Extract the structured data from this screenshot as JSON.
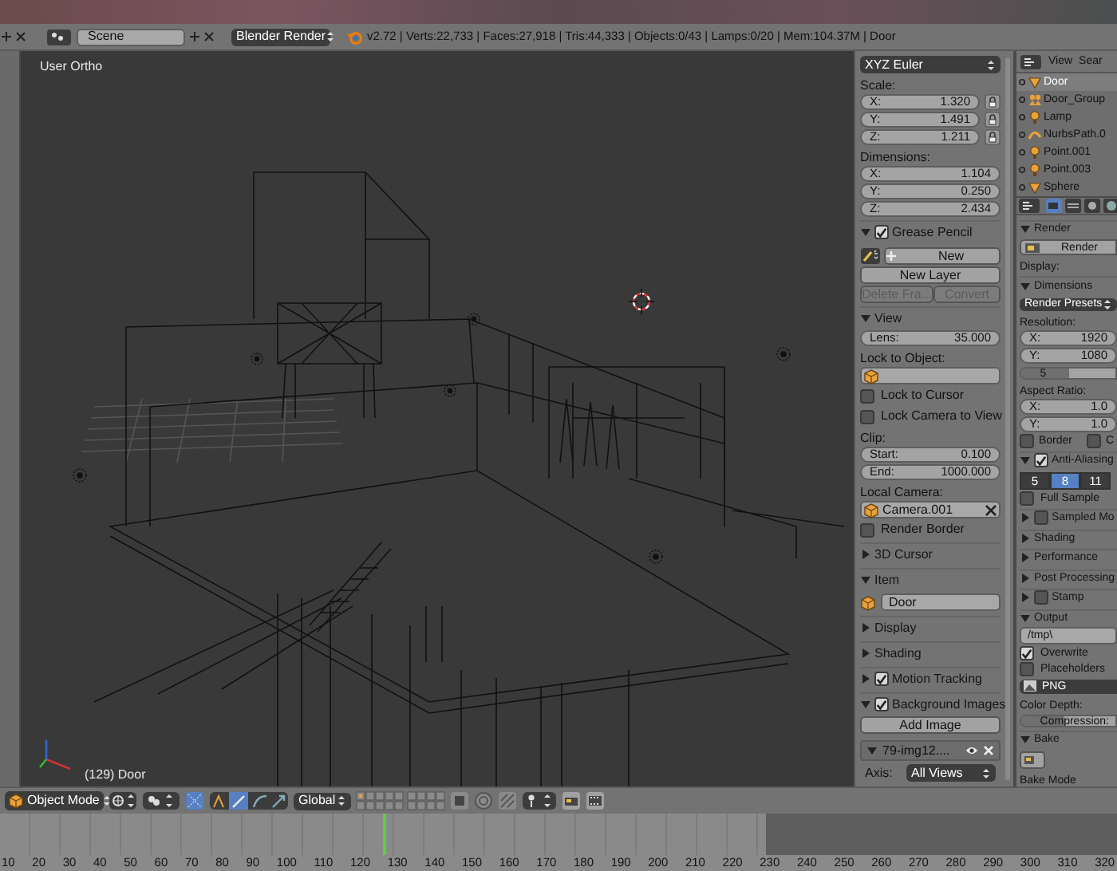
{
  "info_header": {
    "scene": "Scene",
    "engine": "Blender Render",
    "stats": "v2.72 | Verts:22,733 | Faces:27,918 | Tris:44,333 | Objects:0/43 | Lamps:0/20 | Mem:104.37M | Door"
  },
  "viewport": {
    "label": "User Ortho",
    "object_info": "(129) Door"
  },
  "n_panel": [
    {
      "kind": "dropdown",
      "text": "XYZ Euler"
    },
    {
      "kind": "label",
      "text": "Scale:"
    },
    {
      "kind": "locknumber",
      "label": "X:",
      "value": "1.320"
    },
    {
      "kind": "locknumber",
      "label": "Y:",
      "value": "1.491"
    },
    {
      "kind": "locknumber",
      "label": "Z:",
      "value": "1.211"
    },
    {
      "kind": "label",
      "text": "Dimensions:"
    },
    {
      "kind": "number",
      "label": "X:",
      "value": "1.104"
    },
    {
      "kind": "number",
      "label": "Y:",
      "value": "0.250"
    },
    {
      "kind": "number",
      "label": "Z:",
      "value": "2.434"
    },
    {
      "kind": "panel",
      "text": "Grease Pencil",
      "expanded": true,
      "checked": true
    },
    {
      "kind": "tool",
      "text": "New"
    },
    {
      "kind": "button",
      "text": "New Layer",
      "disabled": false
    },
    {
      "kind": "buttons",
      "items": [
        {
          "text": "Delete Fra...",
          "disabled": true
        },
        {
          "text": "Convert",
          "disabled": true
        }
      ]
    },
    {
      "kind": "panel",
      "text": "View",
      "expanded": true
    },
    {
      "kind": "number",
      "label": "Lens:",
      "value": "35.000"
    },
    {
      "kind": "label",
      "text": "Lock to Object:"
    },
    {
      "kind": "object"
    },
    {
      "kind": "checkbox",
      "text": "Lock to Cursor",
      "checked": false
    },
    {
      "kind": "checkbox",
      "text": "Lock Camera to View",
      "checked": false
    },
    {
      "kind": "label",
      "text": "Clip:"
    },
    {
      "kind": "number",
      "label": "Start:",
      "value": "0.100"
    },
    {
      "kind": "number",
      "label": "End:",
      "value": "1000.000"
    },
    {
      "kind": "label",
      "text": "Local Camera:"
    },
    {
      "kind": "object",
      "text": "Camera.001",
      "clearable": true
    },
    {
      "kind": "checkbox",
      "text": "Render Border",
      "checked": false
    },
    {
      "kind": "panel",
      "text": "3D Cursor",
      "expanded": false
    },
    {
      "kind": "panel",
      "text": "Item",
      "expanded": true
    },
    {
      "kind": "name",
      "text": "Door"
    },
    {
      "kind": "panel",
      "text": "Display",
      "expanded": false
    },
    {
      "kind": "panel",
      "text": "Shading",
      "expanded": false
    },
    {
      "kind": "panel",
      "text": "Motion Tracking",
      "expanded": false,
      "checked": true
    },
    {
      "kind": "panel",
      "text": "Background Images",
      "expanded": true,
      "checked": true
    },
    {
      "kind": "button",
      "text": "Add Image",
      "disabled": false
    },
    {
      "kind": "image",
      "text": "79-img12....",
      "expanded": true
    },
    {
      "kind": "select",
      "label": "Axis:",
      "value": "All Views"
    }
  ],
  "outliner": {
    "header": "View",
    "search": "Sear",
    "items": [
      {
        "kind": "mesh",
        "text": "Door",
        "selected": true
      },
      {
        "kind": "group",
        "text": "Door_Group",
        "selected": false
      },
      {
        "kind": "lamp",
        "text": "Lamp",
        "selected": false
      },
      {
        "kind": "curve",
        "text": "NurbsPath.0",
        "selected": false
      },
      {
        "kind": "lamp",
        "text": "Point.001",
        "selected": false
      },
      {
        "kind": "lamp",
        "text": "Point.003",
        "selected": false
      },
      {
        "kind": "mesh",
        "text": "Sphere",
        "selected": false
      }
    ]
  },
  "properties": [
    {
      "kind": "panel",
      "text": "Render",
      "expanded": true
    },
    {
      "kind": "render",
      "text": "Render"
    },
    {
      "kind": "label",
      "text": "Display:"
    },
    {
      "kind": "panel",
      "text": "Dimensions",
      "expanded": true
    },
    {
      "kind": "dropdown",
      "text": "Render Presets"
    },
    {
      "kind": "label",
      "text": "Resolution:"
    },
    {
      "kind": "number",
      "label": "X:",
      "value": "1920"
    },
    {
      "kind": "number",
      "label": "Y:",
      "value": "1080"
    },
    {
      "kind": "slider",
      "text": "5",
      "level": 0.5
    },
    {
      "kind": "label",
      "text": "Aspect Ratio:"
    },
    {
      "kind": "number",
      "label": "X:",
      "value": "1.0"
    },
    {
      "kind": "number",
      "label": "Y:",
      "value": "1.0"
    },
    {
      "kind": "checkpair",
      "items": [
        {
          "text": "Border",
          "checked": false
        },
        {
          "text": "C",
          "checked": false
        }
      ]
    },
    {
      "kind": "panel",
      "text": "Anti-Aliasing",
      "expanded": true,
      "checked": true
    },
    {
      "kind": "segmented",
      "items": [
        {
          "text": "5",
          "selected": false
        },
        {
          "text": "8",
          "selected": true
        },
        {
          "text": "11",
          "selected": false
        }
      ]
    },
    {
      "kind": "checkbox",
      "text": "Full Sample",
      "checked": false
    },
    {
      "kind": "panel",
      "text": "Sampled Mo",
      "expanded": false,
      "checked": false
    },
    {
      "kind": "panel",
      "text": "Shading",
      "expanded": false
    },
    {
      "kind": "panel",
      "text": "Performance",
      "expanded": false
    },
    {
      "kind": "panel",
      "text": "Post Processing",
      "expanded": false
    },
    {
      "kind": "panel",
      "text": "Stamp",
      "expanded": false,
      "checked": false
    },
    {
      "kind": "panel",
      "text": "Output",
      "expanded": true
    },
    {
      "kind": "name",
      "text": "/tmp\\"
    },
    {
      "kind": "checkbox",
      "text": "Overwrite",
      "checked": true
    },
    {
      "kind": "checkbox",
      "text": "Placeholders",
      "checked": false
    },
    {
      "kind": "format",
      "text": "PNG"
    },
    {
      "kind": "label",
      "text": "Color Depth:"
    },
    {
      "kind": "slider",
      "text": "Compression:",
      "level": 0.45
    },
    {
      "kind": "panel",
      "text": "Bake",
      "expanded": true
    },
    {
      "kind": "bakebutton"
    },
    {
      "kind": "label",
      "text": "Bake Mode"
    }
  ],
  "view_header": {
    "mode": "Object Mode",
    "orientation": "Global"
  },
  "timeline": {
    "frames": [
      "10",
      "20",
      "30",
      "40",
      "50",
      "60",
      "70",
      "80",
      "90",
      "100",
      "110",
      "120",
      "130",
      "140",
      "150",
      "160",
      "170",
      "180",
      "190",
      "200",
      "210",
      "220",
      "230",
      "240",
      "250",
      "260",
      "270",
      "280",
      "290",
      "300",
      "310",
      "320"
    ],
    "playhead": {
      "level": 0.343
    }
  }
}
